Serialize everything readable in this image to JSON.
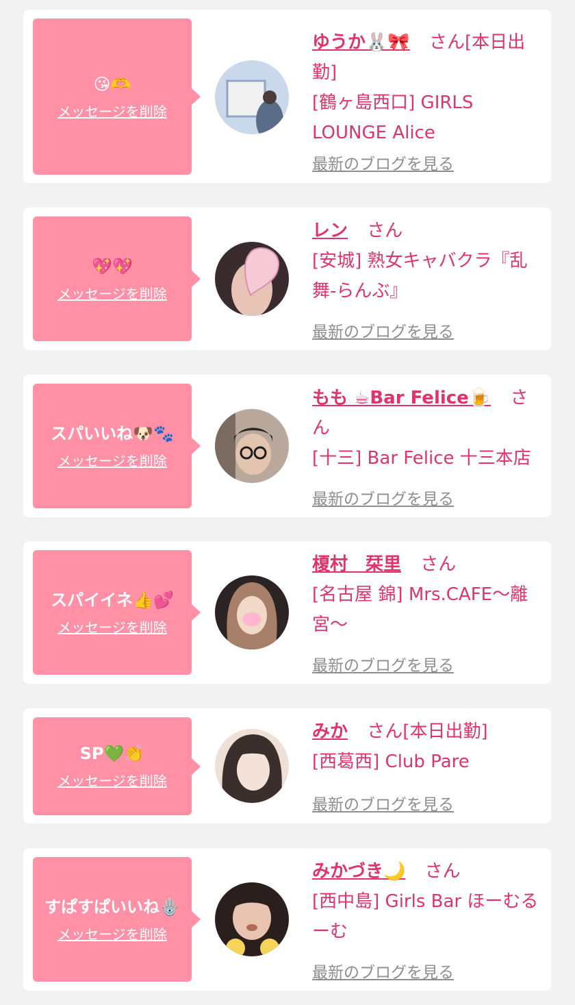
{
  "cards": [
    {
      "stamp": "😘🫶",
      "delete_label": "メッセージを削除",
      "name": "ゆうか🐰🎀",
      "honorific": "さん",
      "status": "[本日出勤]",
      "shop": "[鶴ヶ島西口] GIRLS LOUNGE Alice",
      "blog_label": "最新のブログを見る",
      "avatar_colors": [
        "#c9d8ea",
        "#8fa7c7",
        "#5a6d88"
      ]
    },
    {
      "stamp": "💖💖",
      "delete_label": "メッセージを削除",
      "name": "レン",
      "honorific": "さん",
      "status": "",
      "shop": "[安城] 熟女キャバクラ『乱舞-らんぶ』",
      "blog_label": "最新のブログを見る",
      "avatar_colors": [
        "#f6c9d7",
        "#d98fa8",
        "#3a2b2f"
      ]
    },
    {
      "stamp": "スパいいね🐶🐾",
      "delete_label": "メッセージを削除",
      "name": "もも ☕Bar Felice🍺",
      "honorific": "さん",
      "status": "",
      "shop": "[十三] Bar Felice 十三本店",
      "blog_label": "最新のブログを見る",
      "avatar_colors": [
        "#b9a89c",
        "#7b6b60",
        "#2d2522"
      ]
    },
    {
      "stamp": "スパイイネ👍💕",
      "delete_label": "メッセージを削除",
      "name": "榎村　栞里",
      "honorific": "さん",
      "status": "",
      "shop": "[名古屋 錦] Mrs.CAFE〜離宮〜",
      "blog_label": "最新のブログを見る",
      "avatar_colors": [
        "#e4c7a8",
        "#a8806a",
        "#2c2424"
      ]
    },
    {
      "stamp": "SP💚👏",
      "delete_label": "メッセージを削除",
      "name": "みか",
      "honorific": "さん",
      "status": "[本日出勤]",
      "shop": "[西葛西] Club Pare",
      "blog_label": "最新のブログを見る",
      "avatar_colors": [
        "#efe0d6",
        "#b79c8f",
        "#3b2f2c"
      ]
    },
    {
      "stamp": "すぱすぱいいね🪬",
      "delete_label": "メッセージを削除",
      "name": "みかづき🌙",
      "honorific": "さん",
      "status": "",
      "shop": "[西中島] Girls Bar ほーむるーむ",
      "blog_label": "最新のブログを見る",
      "avatar_colors": [
        "#e8c3b0",
        "#b06a55",
        "#2a1f1d"
      ]
    }
  ]
}
